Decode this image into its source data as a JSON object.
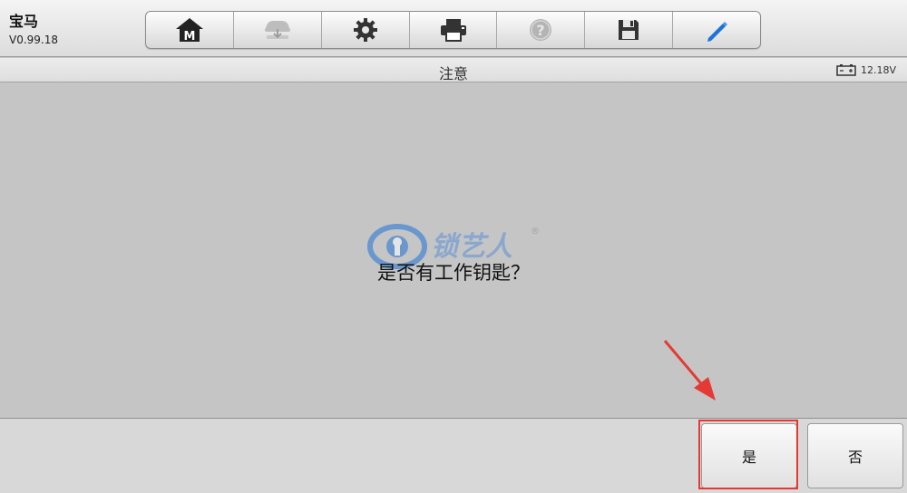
{
  "app": {
    "name": "宝马",
    "version": "V0.99.18"
  },
  "toolbar": {
    "items": [
      {
        "id": "home",
        "icon": "home-m-icon"
      },
      {
        "id": "vehicle",
        "icon": "vehicle-swap-icon"
      },
      {
        "id": "settings",
        "icon": "gear-icon"
      },
      {
        "id": "print",
        "icon": "printer-icon"
      },
      {
        "id": "help",
        "icon": "question-icon"
      },
      {
        "id": "save",
        "icon": "floppy-disk-icon"
      },
      {
        "id": "edit",
        "icon": "pen-icon"
      }
    ]
  },
  "header": {
    "title": "注意"
  },
  "status": {
    "battery_voltage": "12.18V"
  },
  "dialog": {
    "message": "是否有工作钥匙？",
    "yes_label": "是",
    "no_label": "否"
  },
  "watermark": {
    "text": "锁艺人"
  },
  "colors": {
    "accent": "#1e73d6",
    "annotation": "#e53935"
  }
}
